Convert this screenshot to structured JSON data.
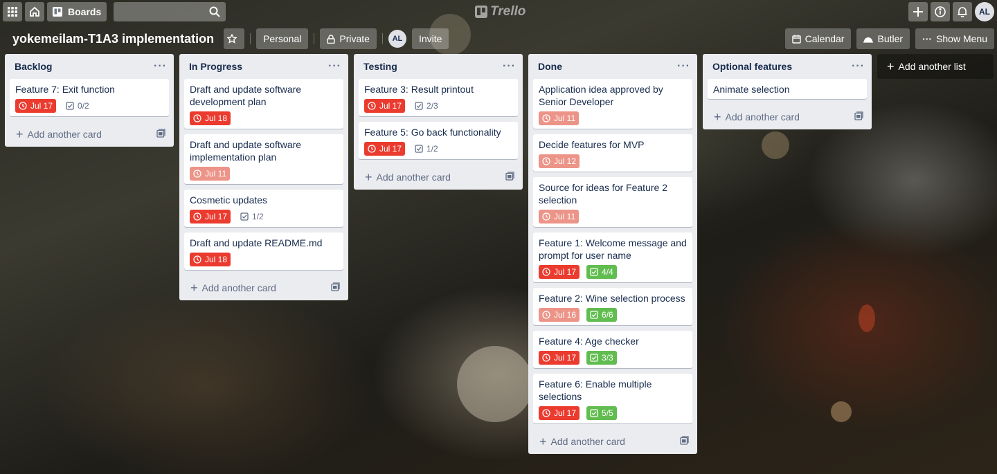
{
  "header": {
    "boards_label": "Boards",
    "search_placeholder": "",
    "logo_text": "Trello",
    "user_initials": "AL"
  },
  "board": {
    "title": "yokemeilam-T1A3 implementation",
    "team_label": "Personal",
    "visibility_label": "Private",
    "member_initials": "AL",
    "invite_label": "Invite",
    "calendar_label": "Calendar",
    "butler_label": "Butler",
    "menu_label": "Show Menu"
  },
  "colors": {
    "due_overdue": "#eb3b2f",
    "due_past": "#ec9488",
    "checklist_complete": "#61bd4f"
  },
  "lists": [
    {
      "name": "Backlog",
      "cards": [
        {
          "title": "Feature 7: Exit function",
          "due": "Jul 17",
          "due_style": "overdue",
          "checklist": "0/2",
          "checklist_done": false
        }
      ],
      "add_label": "Add another card"
    },
    {
      "name": "In Progress",
      "cards": [
        {
          "title": "Draft and update software development plan",
          "due": "Jul 18",
          "due_style": "overdue",
          "checklist": null
        },
        {
          "title": "Draft and update software implementation plan",
          "due": "Jul 11",
          "due_style": "past",
          "checklist": null
        },
        {
          "title": "Cosmetic updates",
          "due": "Jul 17",
          "due_style": "overdue",
          "checklist": "1/2",
          "checklist_done": false
        },
        {
          "title": "Draft and update README.md",
          "due": "Jul 18",
          "due_style": "overdue",
          "checklist": null
        }
      ],
      "add_label": "Add another card"
    },
    {
      "name": "Testing",
      "cards": [
        {
          "title": "Feature 3: Result printout",
          "due": "Jul 17",
          "due_style": "overdue",
          "checklist": "2/3",
          "checklist_done": false
        },
        {
          "title": "Feature 5: Go back functionality",
          "due": "Jul 17",
          "due_style": "overdue",
          "checklist": "1/2",
          "checklist_done": false
        }
      ],
      "add_label": "Add another card"
    },
    {
      "name": "Done",
      "cards": [
        {
          "title": "Application idea approved by Senior Developer",
          "due": "Jul 11",
          "due_style": "past",
          "checklist": null
        },
        {
          "title": "Decide features for MVP",
          "due": "Jul 12",
          "due_style": "past",
          "checklist": null
        },
        {
          "title": "Source for ideas for Feature 2 selection",
          "due": "Jul 11",
          "due_style": "past",
          "checklist": null
        },
        {
          "title": "Feature 1: Welcome message and prompt for user name",
          "due": "Jul 17",
          "due_style": "overdue",
          "checklist": "4/4",
          "checklist_done": true
        },
        {
          "title": "Feature 2: Wine selection process",
          "due": "Jul 16",
          "due_style": "past",
          "checklist": "6/6",
          "checklist_done": true
        },
        {
          "title": "Feature 4: Age checker",
          "due": "Jul 17",
          "due_style": "overdue",
          "checklist": "3/3",
          "checklist_done": true
        },
        {
          "title": "Feature 6: Enable multiple selections",
          "due": "Jul 17",
          "due_style": "overdue",
          "checklist": "5/5",
          "checklist_done": true
        }
      ],
      "add_label": "Add another card"
    },
    {
      "name": "Optional features",
      "cards": [
        {
          "title": "Animate selection",
          "due": null,
          "checklist": null
        }
      ],
      "add_label": "Add another card"
    }
  ],
  "add_list_label": "Add another list"
}
